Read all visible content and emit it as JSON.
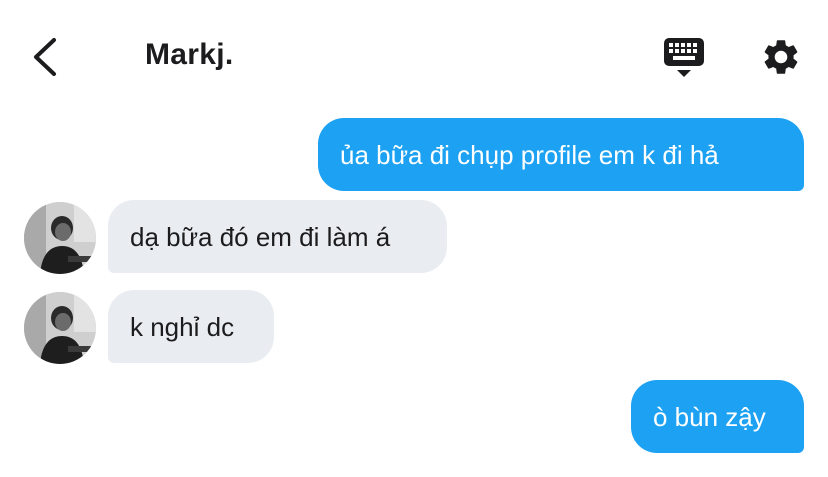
{
  "header": {
    "title": "Markj.",
    "icons": [
      "back-chevron-icon",
      "keyboard-icon",
      "gear-icon"
    ]
  },
  "messages": [
    {
      "direction": "outgoing",
      "text": "ủa bữa đi chụp profile em k đi hả"
    },
    {
      "direction": "incoming",
      "text": "dạ bữa đó em đi làm á"
    },
    {
      "direction": "incoming",
      "text": "k nghỉ dc"
    },
    {
      "direction": "outgoing",
      "text": "ò bùn zậy"
    }
  ],
  "colors": {
    "outgoing_bubble": "#1da1f2",
    "incoming_bubble": "#e9edf1",
    "text_dark": "#1c1c1e"
  }
}
